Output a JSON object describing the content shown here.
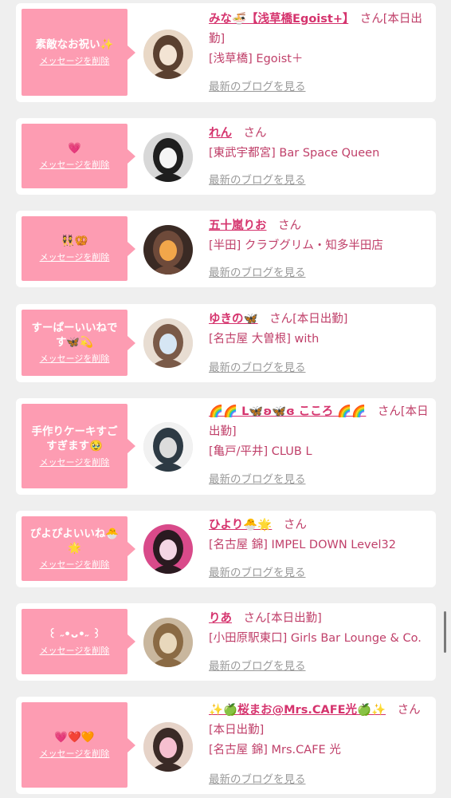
{
  "common": {
    "delete_label": "メッセージを削除",
    "blog_label": "最新のブログを見る",
    "honorific": "さん"
  },
  "entries": [
    {
      "message": "素敵なお祝い✨",
      "name": "みな🍜【浅草橋Egoist+】",
      "status": "[本日出勤]",
      "shop": "[浅草橋] Egoist＋",
      "avatar_icon": "woman-photo-icon",
      "avatar_colors": [
        "#e9d8c6",
        "#5a4030",
        "#f3e4d4"
      ]
    },
    {
      "message": "💗",
      "name": "れん",
      "status": "",
      "shop": "[東武宇都宮] Bar Space Queen",
      "avatar_icon": "woman-photo-icon",
      "avatar_colors": [
        "#d8d8d8",
        "#1e1e1e",
        "#f5f5f5"
      ]
    },
    {
      "message": "👯🥨",
      "name": "五十嵐りお",
      "status": "",
      "shop": "[半田] クラブグリム・知多半田店",
      "avatar_icon": "woman-photo-icon",
      "avatar_colors": [
        "#3a2a24",
        "#6e4a3a",
        "#f2a64a"
      ]
    },
    {
      "message": "すーぱーいいねです🦋💫",
      "name": "ゆきの🦋",
      "status": "[本日出勤]",
      "shop": "[名古屋 大曽根] with",
      "avatar_icon": "woman-photo-icon",
      "avatar_colors": [
        "#e8ddd2",
        "#7a5a48",
        "#d6e6f4"
      ]
    },
    {
      "message": "手作りケーキすごすぎます🥹",
      "name": "🌈🌈 L🦋ʚ🦋ɞ こころ 🌈🌈",
      "status": "[本日出勤]",
      "shop": "[亀戸/平井] CLUB L",
      "avatar_icon": "mannequin-photo-icon",
      "avatar_colors": [
        "#f1f1f1",
        "#2d3a44",
        "#dcdcdc"
      ]
    },
    {
      "message": "ぴよぴよいいね🐣🌟",
      "name": "ひより🐣🌟",
      "status": "",
      "shop": "[名古屋 錦] IMPEL DOWN Level32",
      "avatar_icon": "woman-photo-icon",
      "avatar_colors": [
        "#d94a8a",
        "#2a1a20",
        "#f4d6e4"
      ]
    },
    {
      "message": "꒰ ˶•ᴗ•˶ ꒱",
      "name": "りあ",
      "status": "[本日出勤]",
      "shop": "[小田原駅東口] Girls Bar Lounge & Co.",
      "avatar_icon": "woman-photo-icon",
      "avatar_colors": [
        "#c9b79e",
        "#8a6a44",
        "#e8d8bc"
      ]
    },
    {
      "message": "💗❤️🧡",
      "name": "✨🍏桜まお@Mrs.CAFE光🍏✨",
      "status": "[本日出勤]",
      "shop": "[名古屋 錦] Mrs.CAFE 光",
      "avatar_icon": "woman-photo-icon",
      "avatar_colors": [
        "#e6d3c8",
        "#3a2a26",
        "#f6c0d0"
      ]
    }
  ]
}
